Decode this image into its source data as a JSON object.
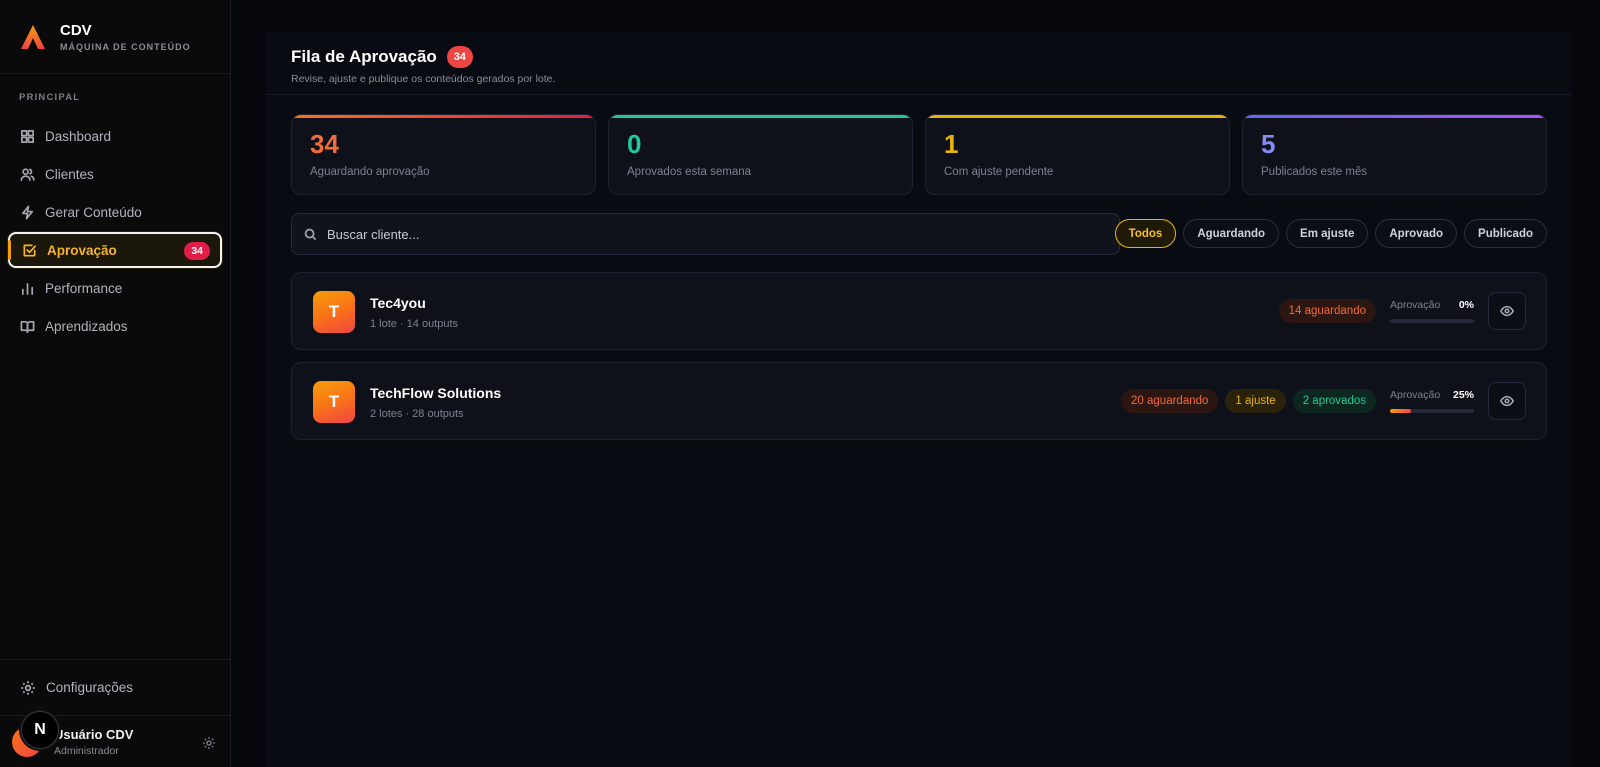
{
  "brand": {
    "name": "CDV",
    "subtitle": "MÁQUINA DE CONTEÚDO"
  },
  "sidebar": {
    "section_label": "PRINCIPAL",
    "items": [
      {
        "label": "Dashboard",
        "icon": "grid-icon"
      },
      {
        "label": "Clientes",
        "icon": "users-icon"
      },
      {
        "label": "Gerar Conteúdo",
        "icon": "lightning-icon"
      },
      {
        "label": "Aprovação",
        "icon": "check-square-icon",
        "badge": "34",
        "active": true
      },
      {
        "label": "Performance",
        "icon": "bar-chart-icon"
      },
      {
        "label": "Aprendizados",
        "icon": "book-icon"
      }
    ],
    "settings_label": "Configurações",
    "user": {
      "name": "Usuário CDV",
      "role": "Administrador"
    },
    "floating_bubble": "N"
  },
  "header": {
    "title": "Fila de Aprovação",
    "badge": "34",
    "subtitle": "Revise, ajuste e publique os conteúdos gerados por lote."
  },
  "stats": [
    {
      "value": "34",
      "label": "Aguardando aprovação",
      "color": "#f26b3a",
      "bar": "#e0453a"
    },
    {
      "value": "0",
      "label": "Aprovados esta semana",
      "color": "#20c997",
      "bar": "#20c997"
    },
    {
      "value": "1",
      "label": "Com ajuste pendente",
      "color": "#eab308",
      "bar": "#eab308"
    },
    {
      "value": "5",
      "label": "Publicados este mês",
      "color": "#818cf8",
      "bar": "#8b5cf6"
    }
  ],
  "search": {
    "placeholder": "Buscar cliente...",
    "value": ""
  },
  "filters": [
    "Todos",
    "Aguardando",
    "Em ajuste",
    "Aprovado",
    "Publicado"
  ],
  "active_filter": "Todos",
  "clients": [
    {
      "initial": "T",
      "name": "Tec4you",
      "meta": "1 lote · 14 outputs",
      "waiting": "14 aguardando",
      "adjust": null,
      "approved": null,
      "progress_label": "Aprovação",
      "progress_pct": "0%",
      "progress_value": 0
    },
    {
      "initial": "T",
      "name": "TechFlow Solutions",
      "meta": "2 lotes · 28 outputs",
      "waiting": "20 aguardando",
      "adjust": "1 ajuste",
      "approved": "2 aprovados",
      "progress_label": "Aprovação",
      "progress_pct": "25%",
      "progress_value": 25
    }
  ]
}
